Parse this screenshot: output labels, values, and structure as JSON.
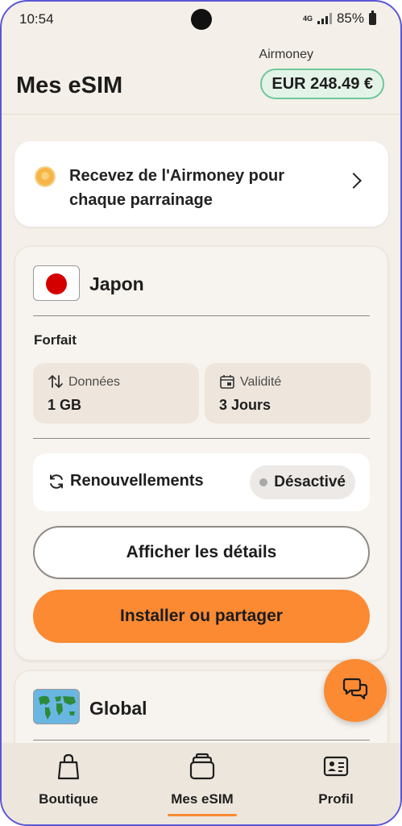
{
  "status_bar": {
    "time": "10:54",
    "network": "4G",
    "battery": "85%"
  },
  "header": {
    "title": "Mes eSIM",
    "wallet_label": "Airmoney",
    "balance": "EUR 248.49 €"
  },
  "promo": {
    "text": "Recevez de l'Airmoney pour chaque parrainage",
    "icon": "coin-icon",
    "action_icon": "chevron-right-icon"
  },
  "esims": [
    {
      "country": "Japon",
      "flag": "japan-flag",
      "plan_label": "Forfait",
      "data_label": "Données",
      "data_value": "1 GB",
      "validity_label": "Validité",
      "validity_value": "3 Jours",
      "renewal_label": "Renouvellements",
      "renewal_status": "Désactivé",
      "details_button": "Afficher les détails",
      "install_button": "Installer ou partager"
    },
    {
      "country": "Global",
      "flag": "world-map-flag"
    }
  ],
  "fab": {
    "icon": "chat-bubbles-icon"
  },
  "bottom_nav": {
    "items": [
      {
        "label": "Boutique",
        "icon": "shopping-bag-icon"
      },
      {
        "label": "Mes eSIM",
        "icon": "sim-cards-icon",
        "active": true
      },
      {
        "label": "Profil",
        "icon": "id-card-icon"
      }
    ]
  },
  "colors": {
    "accent": "#fb8a33",
    "background": "#f4efe8",
    "balance_border": "#6ec79a",
    "balance_fill": "#e4f3e8",
    "japan_red": "#d40000"
  }
}
